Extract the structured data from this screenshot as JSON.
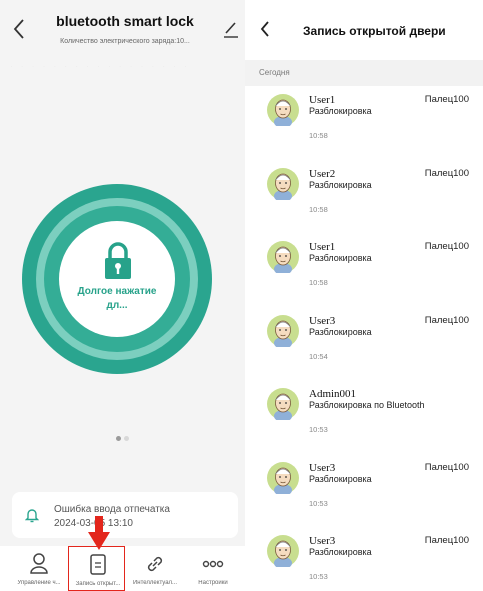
{
  "left": {
    "title": "bluetooth smart lock",
    "subtitle": "Количество электрического заряда:10...",
    "lock_button_label": "Долгое нажатие дл...",
    "notice": {
      "title": "Ошибка ввода отпечатка",
      "datetime": "2024-03-05 13:10"
    },
    "tabs": [
      {
        "label": "Управление ч...",
        "icon": "user-icon"
      },
      {
        "label": "Запись открыт...",
        "icon": "record-icon",
        "selected": true
      },
      {
        "label": "Интеллектуал...",
        "icon": "link-icon"
      },
      {
        "label": "Настройки",
        "icon": "more-icon"
      }
    ],
    "colors": {
      "accent": "#2aa58f",
      "highlight": "#e3261c"
    }
  },
  "right": {
    "title": "Запись открытой двери",
    "section": "Сегодня",
    "records": [
      {
        "name": "User1",
        "action": "Разблокировка",
        "method": "Палец100",
        "time": "10:58"
      },
      {
        "name": "User2",
        "action": "Разблокировка",
        "method": "Палец100",
        "time": "10:58"
      },
      {
        "name": "User1",
        "action": "Разблокировка",
        "method": "Палец100",
        "time": "10:58"
      },
      {
        "name": "User3",
        "action": "Разблокировка",
        "method": "Палец100",
        "time": "10:54"
      },
      {
        "name": "Admin001",
        "action": "Разблокировка по Bluetooth",
        "method": "",
        "time": "10:53"
      },
      {
        "name": "User3",
        "action": "Разблокировка",
        "method": "Палец100",
        "time": "10:53"
      },
      {
        "name": "User3",
        "action": "Разблокировка",
        "method": "Палец100",
        "time": "10:53"
      }
    ]
  }
}
